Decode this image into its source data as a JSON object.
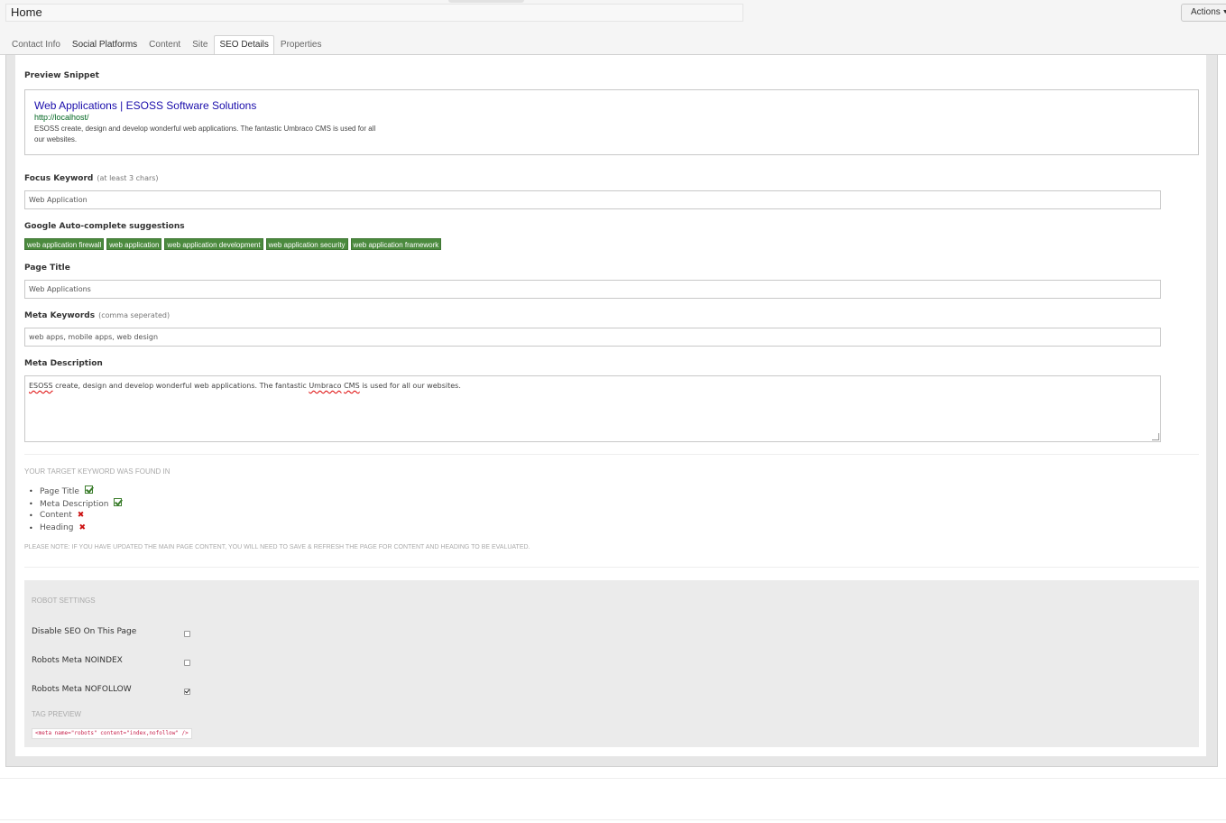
{
  "header": {
    "page_name": "Home",
    "actions_label": "Actions"
  },
  "tabs": [
    {
      "label": "Contact Info"
    },
    {
      "label": "Social Platforms"
    },
    {
      "label": "Content"
    },
    {
      "label": "Site"
    },
    {
      "label": "SEO Details"
    },
    {
      "label": "Properties"
    }
  ],
  "active_tab": "SEO Details",
  "preview": {
    "heading": "Preview Snippet",
    "title": "Web Applications | ESOSS Software Solutions",
    "url": "http://localhost/",
    "description": "ESOSS create, design and develop wonderful web applications. The fantastic Umbraco CMS is used for all our websites."
  },
  "focus_keyword": {
    "label": "Focus Keyword",
    "hint": "(at least 3 chars)",
    "value": "Web Application"
  },
  "autocomplete": {
    "label": "Google Auto-complete suggestions",
    "suggestions": [
      "web application firewall",
      "web application",
      "web application development",
      "web application security",
      "web application framework"
    ]
  },
  "page_title": {
    "label": "Page Title",
    "value": "Web Applications"
  },
  "meta_keywords": {
    "label": "Meta Keywords",
    "hint": "(comma seperated)",
    "value": "web apps, mobile apps, web design"
  },
  "meta_description": {
    "label": "Meta Description",
    "value_parts": [
      "ESOSS",
      " create, design and develop wonderful web applications. The fantastic ",
      "Umbraco",
      " ",
      "CMS",
      " is used for all our websites."
    ]
  },
  "keyword_found": {
    "heading": "YOUR TARGET KEYWORD WAS FOUND IN",
    "items": [
      {
        "label": "Page Title",
        "found": true
      },
      {
        "label": "Meta Description",
        "found": true
      },
      {
        "label": "Content",
        "found": false
      },
      {
        "label": "Heading",
        "found": false
      }
    ],
    "note": "PLEASE NOTE: IF YOU HAVE UPDATED THE MAIN PAGE CONTENT, YOU WILL NEED TO SAVE & REFRESH THE PAGE FOR CONTENT AND HEADING TO BE EVALUATED."
  },
  "robot_settings": {
    "heading": "ROBOT SETTINGS",
    "options": [
      {
        "label": "Disable SEO On This Page",
        "checked": false
      },
      {
        "label": "Robots Meta NOINDEX",
        "checked": false
      },
      {
        "label": "Robots Meta NOFOLLOW",
        "checked": true
      }
    ],
    "tag_preview_heading": "TAG PREVIEW",
    "tag_preview": "<meta name=\"robots\" content=\"index,nofollow\" />"
  },
  "colors": {
    "tag_green": "#4b8a3e",
    "link_blue": "#1a0dab",
    "url_green": "#006621",
    "check_green": "#3b7d2c",
    "cross_red": "#cc1111"
  }
}
